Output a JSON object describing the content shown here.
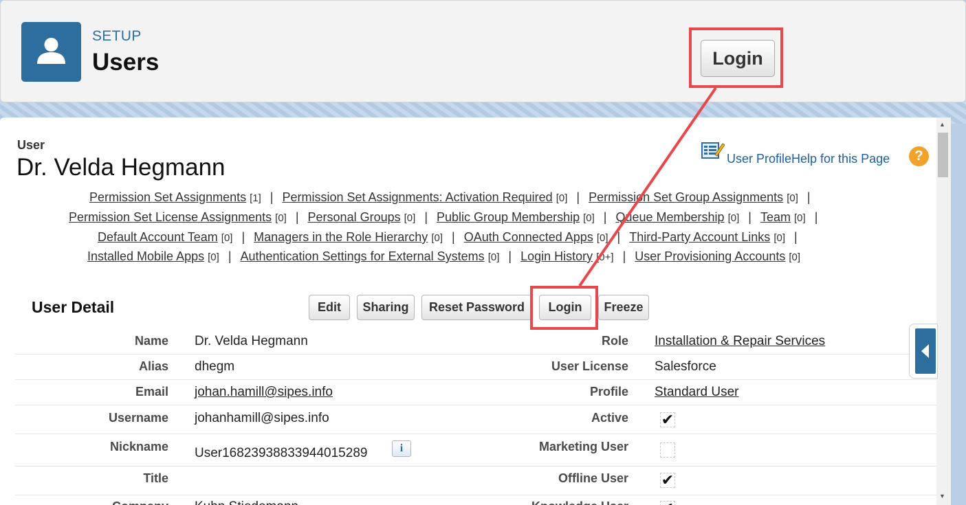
{
  "header": {
    "setup_label": "SETUP",
    "title": "Users",
    "login_button": "Login"
  },
  "user": {
    "label": "User",
    "name": "Dr. Velda Hegmann"
  },
  "help": {
    "profile_link": "User ProfileHelp for this Page",
    "help_icon": "?"
  },
  "related_lines": [
    [
      {
        "text": "Permission Set Assignments",
        "count": "[1]"
      },
      {
        "text": "Permission Set Assignments: Activation Required",
        "count": "[0]"
      },
      {
        "text": "Permission Set Group Assignments",
        "count": "[0]"
      }
    ],
    [
      {
        "text": "Permission Set License Assignments",
        "count": "[0]"
      },
      {
        "text": "Personal Groups",
        "count": "[0]"
      },
      {
        "text": "Public Group Membership",
        "count": "[0]"
      },
      {
        "text": "Queue Membership",
        "count": "[0]"
      },
      {
        "text": "Team",
        "count": "[0]"
      }
    ],
    [
      {
        "text": "Default Account Team",
        "count": "[0]"
      },
      {
        "text": "Managers in the Role Hierarchy",
        "count": "[0]"
      },
      {
        "text": "OAuth Connected Apps",
        "count": "[0]"
      },
      {
        "text": "Third-Party Account Links",
        "count": "[0]"
      }
    ],
    [
      {
        "text": "Installed Mobile Apps",
        "count": "[0]"
      },
      {
        "text": "Authentication Settings for External Systems",
        "count": "[0]"
      },
      {
        "text": "Login History",
        "count": "[0+]"
      },
      {
        "text": "User Provisioning Accounts",
        "count": "[0]"
      }
    ]
  ],
  "detail": {
    "title": "User Detail",
    "buttons": {
      "edit": "Edit",
      "sharing": "Sharing",
      "reset_password": "Reset Password",
      "login": "Login",
      "freeze": "Freeze"
    },
    "left": {
      "name_label": "Name",
      "name": "Dr. Velda Hegmann",
      "alias_label": "Alias",
      "alias": "dhegm",
      "email_label": "Email",
      "email": "johan.hamill@sipes.info",
      "username_label": "Username",
      "username": "johanhamill@sipes.info",
      "nickname_label": "Nickname",
      "nickname": "User16823938833944015289",
      "title_label": "Title",
      "title": "",
      "company_label": "Company",
      "company": "Kuhn Stiedemann"
    },
    "right": {
      "role_label": "Role",
      "role": "Installation & Repair Services",
      "license_label": "User License",
      "license": "Salesforce",
      "profile_label": "Profile",
      "profile": "Standard User",
      "active_label": "Active",
      "active": true,
      "marketing_label": "Marketing User",
      "marketing": false,
      "offline_label": "Offline User",
      "offline": true,
      "knowledge_label": "Knowledge User",
      "knowledge": true
    },
    "check_glyph": "✔"
  },
  "colors": {
    "accent": "#2e6e9e",
    "highlight": "#e8474b",
    "link": "#1b5fa6"
  }
}
